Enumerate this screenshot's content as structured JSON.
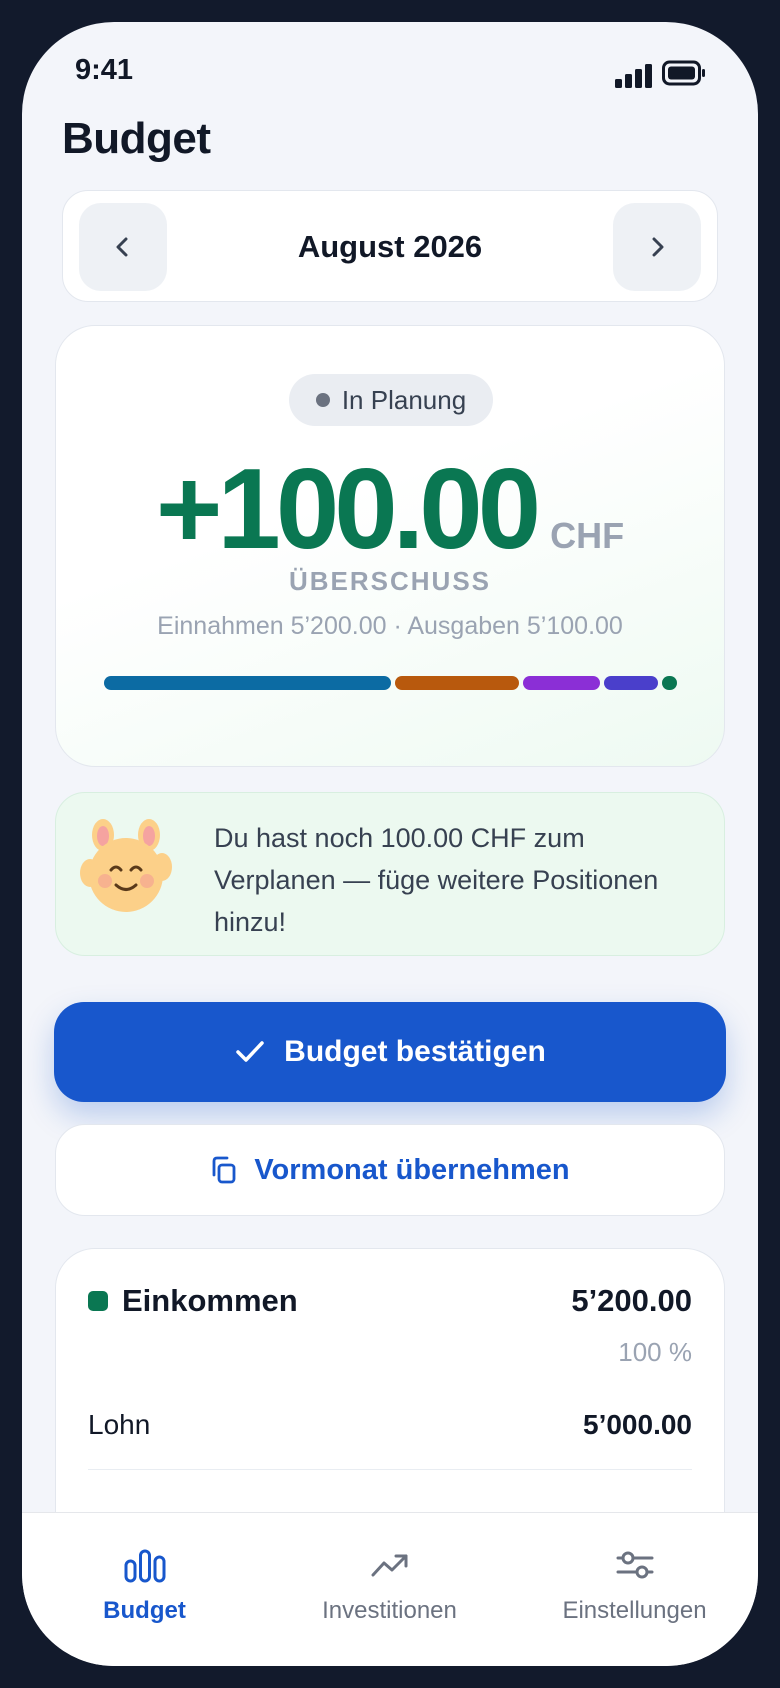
{
  "status_bar": {
    "time": "9:41"
  },
  "header": {
    "title": "Budget"
  },
  "month_selector": {
    "label": "August 2026"
  },
  "summary": {
    "status": "In Planung",
    "amount": "+100.00",
    "currency": "CHF",
    "label": "ÜBERSCHUSS",
    "detail": "Einnahmen 5’200.00 · Ausgaben 5’100.00",
    "bar_segments": [
      {
        "color": "#0c6ba3",
        "share": 51.5
      },
      {
        "color": "#b8590d",
        "share": 22.3
      },
      {
        "color": "#8b2fd6",
        "share": 13.9
      },
      {
        "color": "#4a3fcb",
        "share": 9.7
      },
      {
        "color": "#0a7752",
        "share": 2.6
      }
    ]
  },
  "tip": {
    "text": "Du hast noch 100.00 CHF zum Verplanen — füge weitere Positionen hinzu!"
  },
  "actions": {
    "confirm_label": "Budget bestätigen",
    "copy_label": "Vormonat übernehmen"
  },
  "income": {
    "name": "Einkommen",
    "total": "5’200.00",
    "percent": "100 %",
    "items": [
      {
        "label": "Lohn",
        "amount": "5’000.00"
      }
    ]
  },
  "tabs": [
    {
      "label": "Budget",
      "icon": "bar-chart-icon",
      "active": true
    },
    {
      "label": "Investitionen",
      "icon": "trending-up-icon",
      "active": false
    },
    {
      "label": "Einstellungen",
      "icon": "sliders-icon",
      "active": false
    }
  ],
  "colors": {
    "accent": "#1857cc",
    "positive": "#0a7752",
    "muted": "#9aa3b2"
  }
}
